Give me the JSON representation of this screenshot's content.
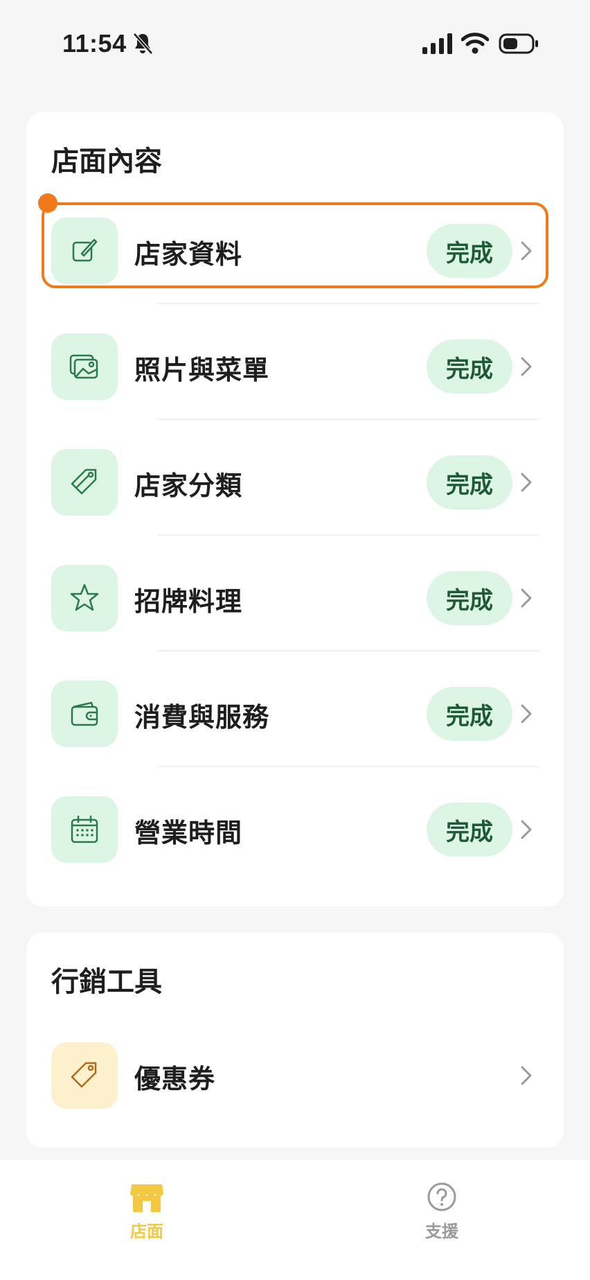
{
  "status_bar": {
    "time": "11:54"
  },
  "store_content": {
    "title": "店面內容",
    "items": [
      {
        "label": "店家資料",
        "status": "完成",
        "icon": "edit-icon"
      },
      {
        "label": "照片與菜單",
        "status": "完成",
        "icon": "photo-icon"
      },
      {
        "label": "店家分類",
        "status": "完成",
        "icon": "tag-icon"
      },
      {
        "label": "招牌料理",
        "status": "完成",
        "icon": "star-icon"
      },
      {
        "label": "消費與服務",
        "status": "完成",
        "icon": "wallet-icon"
      },
      {
        "label": "營業時間",
        "status": "完成",
        "icon": "calendar-icon"
      }
    ]
  },
  "marketing_tools": {
    "title": "行銷工具",
    "items": [
      {
        "label": "優惠券",
        "icon": "coupon-icon"
      }
    ]
  },
  "tab_bar": {
    "tabs": [
      {
        "label": "店面",
        "icon": "store-icon",
        "active": true
      },
      {
        "label": "支援",
        "icon": "help-icon",
        "active": false
      }
    ]
  },
  "colors": {
    "accent_green": "#1f5a36",
    "badge_bg": "#dcf5e5",
    "highlight": "#f07a1a",
    "active_tab": "#f5c842",
    "coupon_bg": "#fdf0cc"
  }
}
